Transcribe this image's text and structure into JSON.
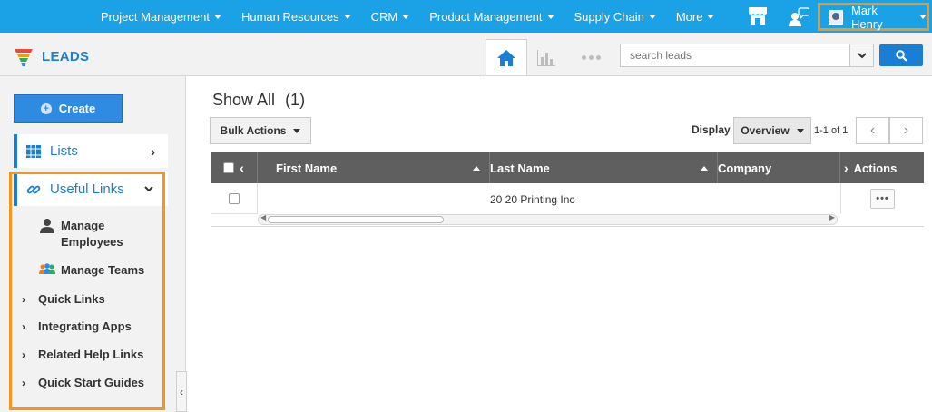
{
  "topnav": {
    "menu": [
      {
        "label": "Project Management"
      },
      {
        "label": "Human Resources"
      },
      {
        "label": "CRM"
      },
      {
        "label": "Product Management"
      },
      {
        "label": "Supply Chain"
      },
      {
        "label": "More"
      }
    ],
    "user_name": "Mark Henry",
    "icons": [
      "store-icon",
      "chat-icon",
      "user-avatar-icon"
    ]
  },
  "app": {
    "title": "LEADS",
    "search": {
      "placeholder": "search leads",
      "value": ""
    }
  },
  "sidebar": {
    "create_label": "Create",
    "lists_label": "Lists",
    "useful_links_label": "Useful Links",
    "useful_links_items": [
      {
        "label": "Manage Employees",
        "icon": "person-icon"
      },
      {
        "label": "Manage Teams",
        "icon": "team-icon"
      }
    ],
    "sections": [
      {
        "label": "Quick Links"
      },
      {
        "label": "Integrating Apps"
      },
      {
        "label": "Related Help Links"
      },
      {
        "label": "Quick Start Guides"
      }
    ]
  },
  "main": {
    "title": "Show All",
    "count": "(1)",
    "bulk_actions_label": "Bulk Actions",
    "display_label": "Display",
    "display_value": "Overview",
    "pager_text": "1-1 of 1",
    "columns": [
      "First Name",
      "Last Name",
      "Company",
      "Actions"
    ],
    "rows": [
      {
        "first_name": "",
        "last_name": "",
        "company": "20 20 Printing Inc"
      }
    ]
  },
  "colors": {
    "topnav": "#1ba2e6",
    "accent": "#1a7fd4",
    "highlight_frame": "#f7941d",
    "table_header": "#5f5f5f"
  }
}
